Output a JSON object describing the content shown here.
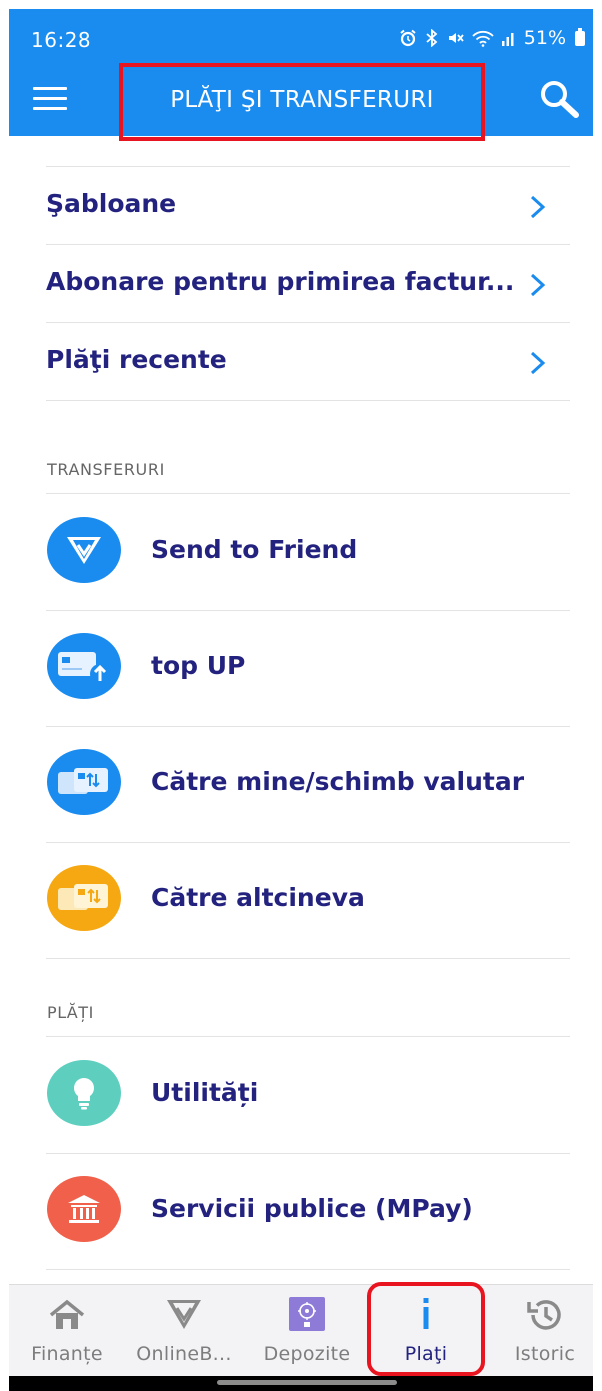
{
  "status_bar": {
    "time": "16:28",
    "battery_percent": "51%"
  },
  "header": {
    "title": "PLĂŢI ŞI TRANSFERURI",
    "background_color": "#1a8cf0",
    "highlight_color": "#e8141f"
  },
  "links": [
    {
      "label": "Şabloane"
    },
    {
      "label": "Abonare pentru primirea factur..."
    },
    {
      "label": "Plăţi recente"
    }
  ],
  "sections": {
    "transfers": {
      "header": "TRANSFERURI",
      "items": [
        {
          "label": "Send to Friend",
          "icon": "send-to-friend-icon",
          "color": "#1a8cf0"
        },
        {
          "label": "top UP",
          "icon": "card-topup-icon",
          "color": "#1a8cf0"
        },
        {
          "label": "Către mine/schimb valutar",
          "icon": "card-exchange-icon",
          "color": "#1a8cf0"
        },
        {
          "label": "Către altcineva",
          "icon": "card-transfer-icon",
          "color": "#f5a812"
        }
      ]
    },
    "payments": {
      "header": "PLĂȚI",
      "items": [
        {
          "label": "Utilități",
          "icon": "lightbulb-icon",
          "color": "#5ecfbf"
        },
        {
          "label": "Servicii publice (MPay)",
          "icon": "government-building-icon",
          "color": "#f0604a"
        }
      ]
    }
  },
  "bottom_nav": {
    "items": [
      {
        "label": "Finanțe",
        "icon": "home-icon"
      },
      {
        "label": "OnlineB...",
        "icon": "onlineb-logo-icon"
      },
      {
        "label": "Depozite",
        "icon": "deposit-icon"
      },
      {
        "label": "Plaţi",
        "icon": "info-icon",
        "active": true
      },
      {
        "label": "Istoric",
        "icon": "history-icon"
      }
    ]
  },
  "colors": {
    "text_primary": "#23237f",
    "accent_blue": "#1a8cf0",
    "divider": "#e3e3e3"
  }
}
